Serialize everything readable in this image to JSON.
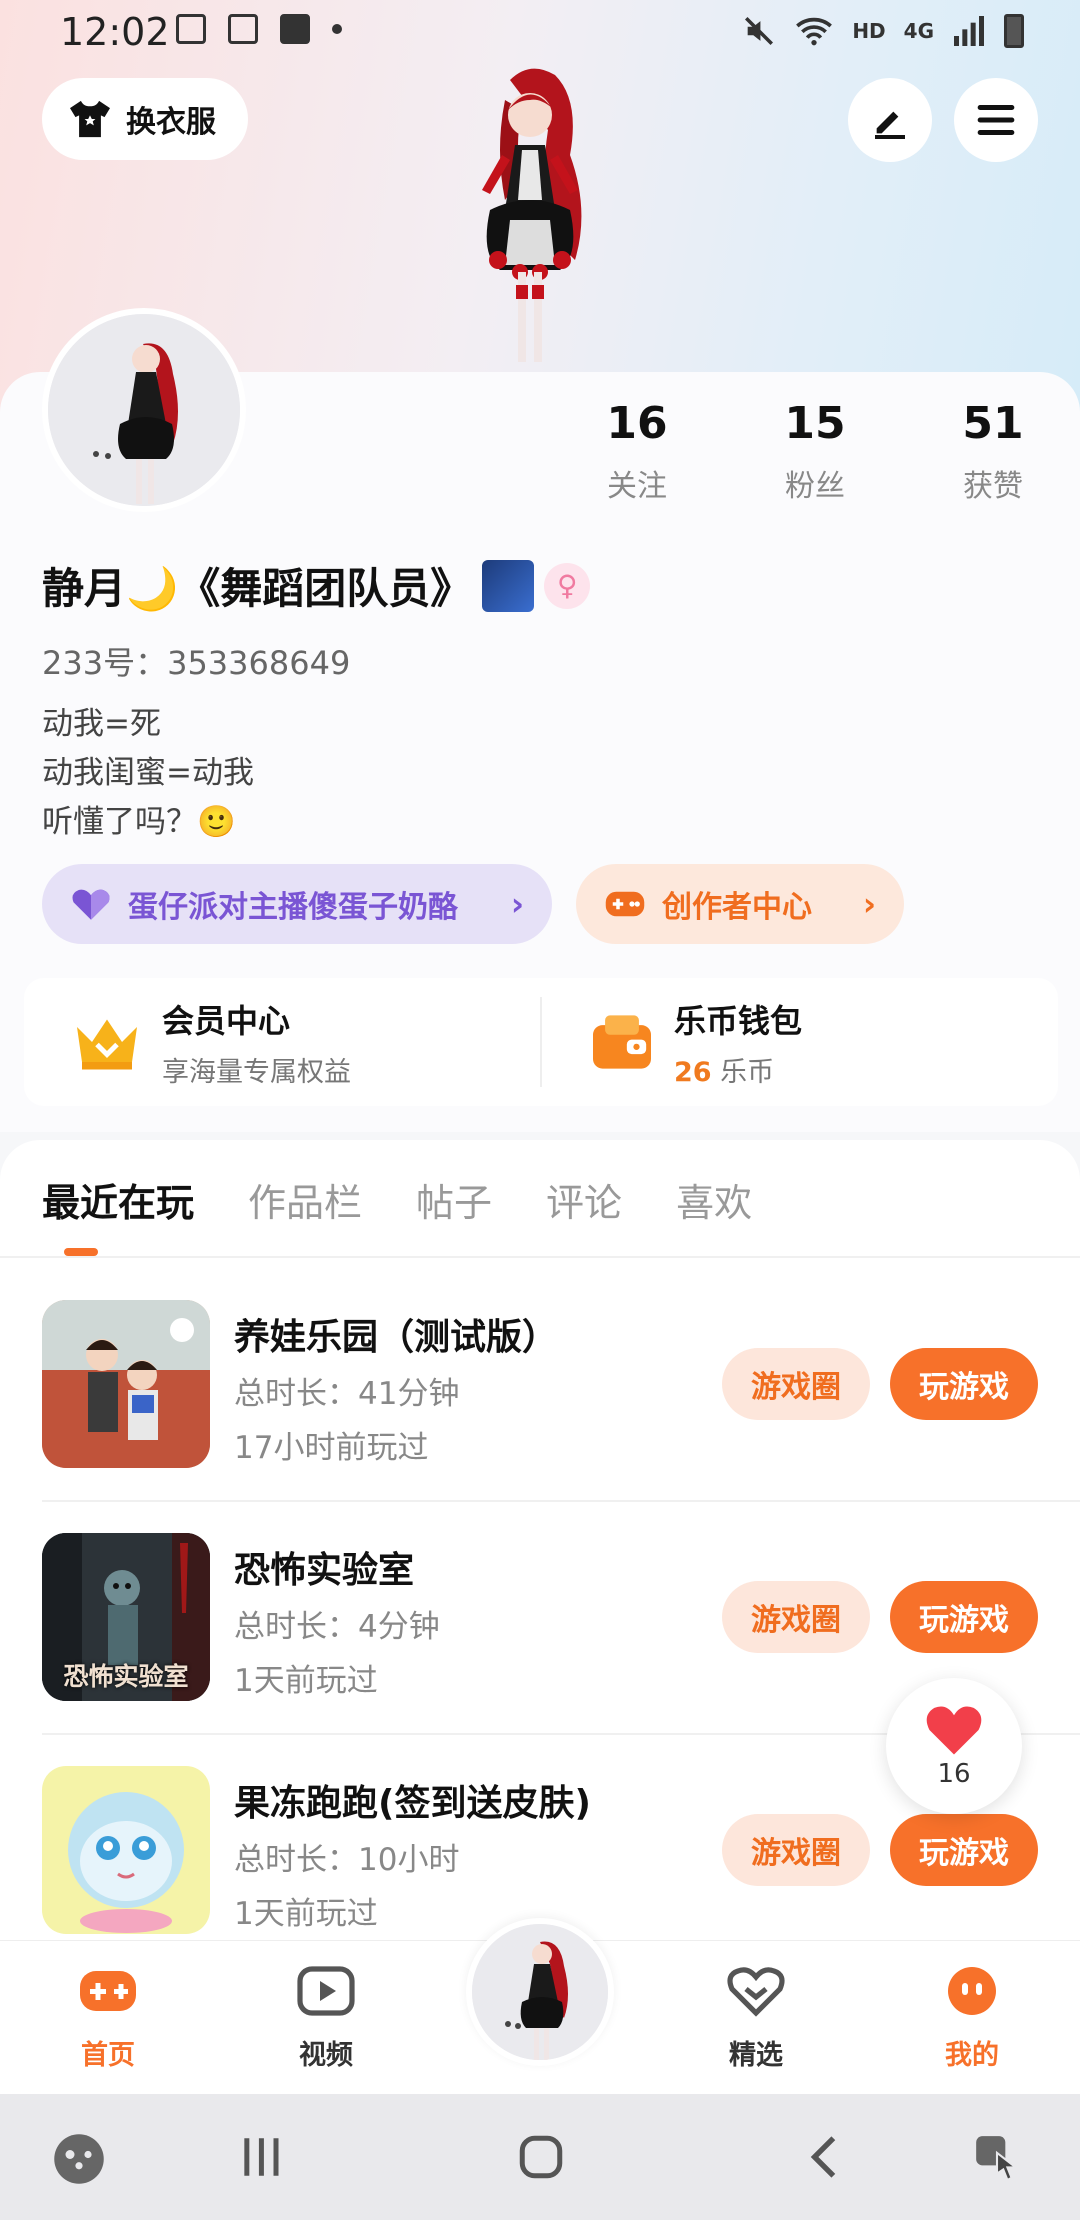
{
  "status_bar": {
    "time": "12:02",
    "network": "HD",
    "cell": "4G"
  },
  "header": {
    "outfit_label": "换衣服"
  },
  "stats": [
    {
      "value": "16",
      "label": "关注"
    },
    {
      "value": "15",
      "label": "粉丝"
    },
    {
      "value": "51",
      "label": "获赞"
    }
  ],
  "profile": {
    "name": "静月🌙《舞蹈团队员》",
    "gender_symbol": "♀",
    "uid": "233号：353368649",
    "bio": [
      "动我=死",
      "动我闺蜜=动我",
      "听懂了吗？🙂"
    ]
  },
  "tags": {
    "anchor": "蛋仔派对主播傻蛋子奶酪",
    "creator": "创作者中心"
  },
  "vip": {
    "member_title": "会员中心",
    "member_sub": "享海量专属权益",
    "wallet_title": "乐币钱包",
    "wallet_amount": "26",
    "wallet_unit": " 乐币"
  },
  "tabs": [
    "最近在玩",
    "作品栏",
    "帖子",
    "评论",
    "喜欢"
  ],
  "games": [
    {
      "title": "养娃乐园（测试版）",
      "duration": "总时长：41分钟",
      "last": "17小时前玩过",
      "circle": "游戏圈",
      "play": "玩游戏"
    },
    {
      "title": "恐怖实验室",
      "duration": "总时长：4分钟",
      "last": "1天前玩过",
      "circle": "游戏圈",
      "play": "玩游戏",
      "thumb_text": "恐怖实验室"
    },
    {
      "title": "果冻跑跑(签到送皮肤)",
      "duration": "总时长：10小时",
      "last": "1天前玩过",
      "circle": "游戏圈",
      "play": "玩游戏"
    }
  ],
  "float_like": {
    "count": "16"
  },
  "bottom_nav": [
    {
      "label": "首页",
      "active": true
    },
    {
      "label": "视频",
      "active": false
    },
    {
      "label": "精选",
      "active": false
    },
    {
      "label": "我的",
      "active": true
    }
  ],
  "colors": {
    "accent": "#f7712a",
    "purple": "#7a55d4",
    "bg": "#f6f7f9"
  }
}
